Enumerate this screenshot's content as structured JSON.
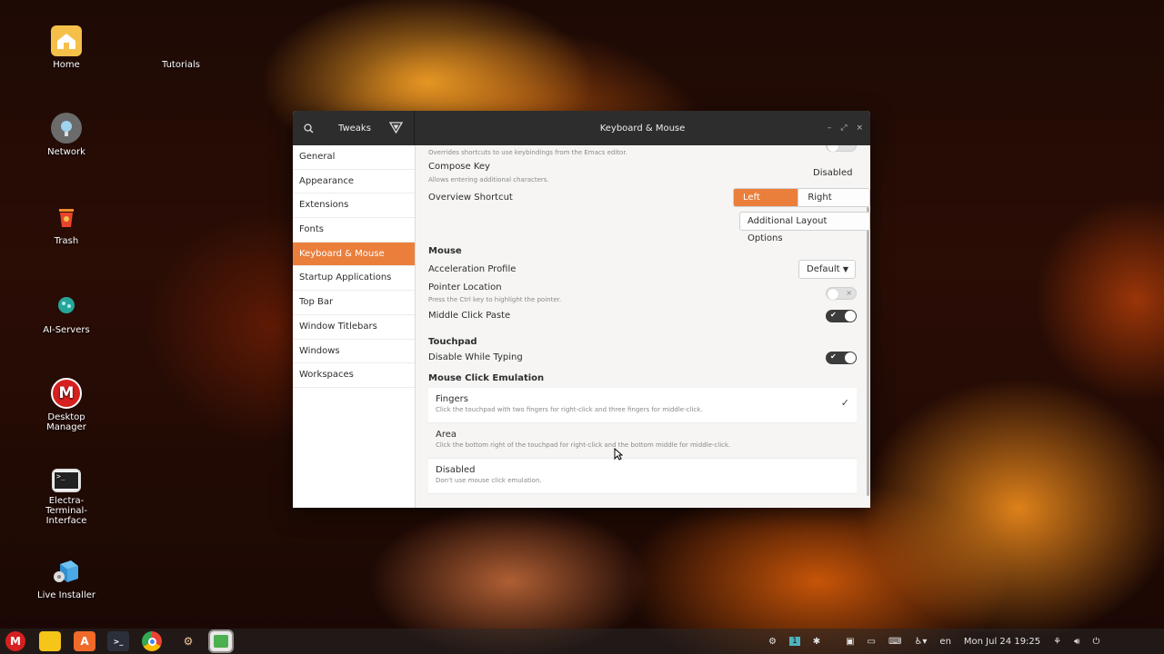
{
  "desktop": {
    "icons": [
      {
        "label": "Home",
        "icon": "home-folder-icon"
      },
      {
        "label": "Tutorials",
        "icon": "folder-icon"
      },
      {
        "label": "Network",
        "icon": "network-icon"
      },
      {
        "label": "Trash",
        "icon": "trash-icon"
      },
      {
        "label": "AI-Servers",
        "icon": "ai-brain-icon"
      },
      {
        "label": "Desktop Manager",
        "icon": "desktop-manager-icon"
      },
      {
        "label": "Electra-Terminal-Interface",
        "icon": "terminal-icon"
      },
      {
        "label": "Live Installer",
        "icon": "installer-icon"
      }
    ]
  },
  "window": {
    "app_title": "Tweaks",
    "page_title": "Keyboard & Mouse",
    "controls": {
      "minimize": "–",
      "maximize": "⤢",
      "close": "×"
    }
  },
  "sidebar": {
    "items": [
      {
        "label": "General"
      },
      {
        "label": "Appearance"
      },
      {
        "label": "Extensions"
      },
      {
        "label": "Fonts"
      },
      {
        "label": "Keyboard & Mouse",
        "active": true
      },
      {
        "label": "Startup Applications"
      },
      {
        "label": "Top Bar"
      },
      {
        "label": "Window Titlebars"
      },
      {
        "label": "Windows"
      },
      {
        "label": "Workspaces"
      }
    ]
  },
  "keyboard": {
    "emacs_sub": "Overrides shortcuts to use keybindings from the Emacs editor.",
    "compose_key": {
      "label": "Compose Key",
      "sub": "Allows entering additional characters.",
      "value": "Disabled"
    },
    "overview_shortcut": {
      "label": "Overview Shortcut",
      "options": [
        "Left Super",
        "Right Super"
      ],
      "selected": "Left Super"
    },
    "additional_layout_button": "Additional Layout Options"
  },
  "mouse": {
    "section": "Mouse",
    "accel_profile": {
      "label": "Acceleration Profile",
      "value": "Default"
    },
    "pointer_location": {
      "label": "Pointer Location",
      "sub": "Press the Ctrl key to highlight the pointer.",
      "enabled": false
    },
    "middle_click_paste": {
      "label": "Middle Click Paste",
      "enabled": true
    }
  },
  "touchpad": {
    "section": "Touchpad",
    "disable_while_typing": {
      "label": "Disable While Typing",
      "enabled": true
    },
    "emulation_section": "Mouse Click Emulation",
    "emulation_options": [
      {
        "label": "Fingers",
        "sub": "Click the touchpad with two fingers for right-click and three fingers for middle-click.",
        "selected": true
      },
      {
        "label": "Area",
        "sub": "Click the bottom right of the touchpad for right-click and the bottom middle for middle-click.",
        "selected": false
      },
      {
        "label": "Disabled",
        "sub": "Don't use mouse click emulation.",
        "selected": false
      }
    ]
  },
  "taskbar": {
    "workspace": "1",
    "keyboard_layout": "en",
    "clock": "Mon Jul 24  19:25",
    "accent": "#ea7f3c"
  }
}
